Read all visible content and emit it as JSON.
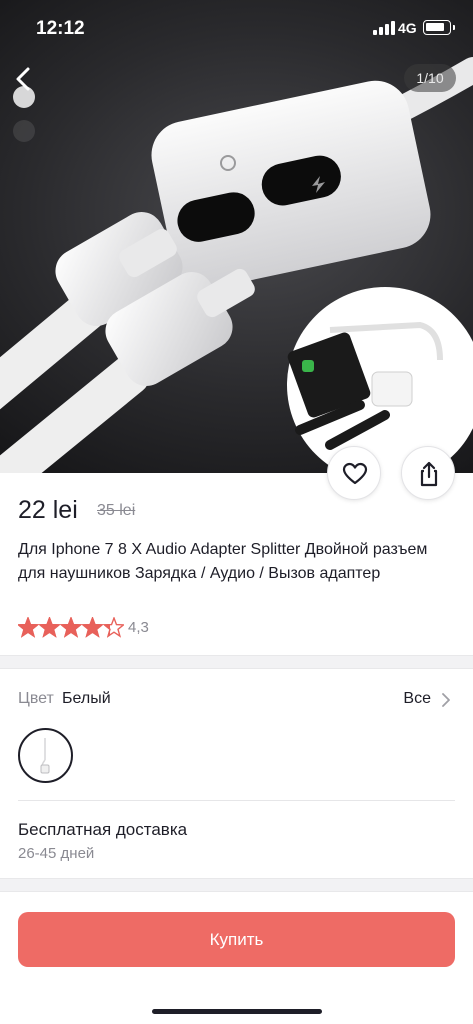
{
  "status_bar": {
    "time": "12:12",
    "network": "4G"
  },
  "gallery": {
    "counter": "1/10"
  },
  "product": {
    "price": "22 lei",
    "old_price": "35 lei",
    "title": "Для Iphone 7 8 X Audio Adapter Splitter Двойной разъем для наушников Зарядка / Аудио / Вызов адаптер",
    "rating": "4,3",
    "rating_value": 4.3,
    "rating_max": 5
  },
  "color": {
    "label": "Цвет",
    "value": "Белый",
    "all_label": "Все"
  },
  "delivery": {
    "title": "Бесплатная доставка",
    "days": "26-45 дней"
  },
  "buy_button": {
    "label": "Купить"
  },
  "colors": {
    "accent": "#ee6b65",
    "star": "#e8615a",
    "text": "#1e1e28",
    "muted": "#8a8a92"
  },
  "icons": [
    "back-icon",
    "heart-icon",
    "share-icon",
    "star-icon",
    "chevron-right-icon"
  ]
}
